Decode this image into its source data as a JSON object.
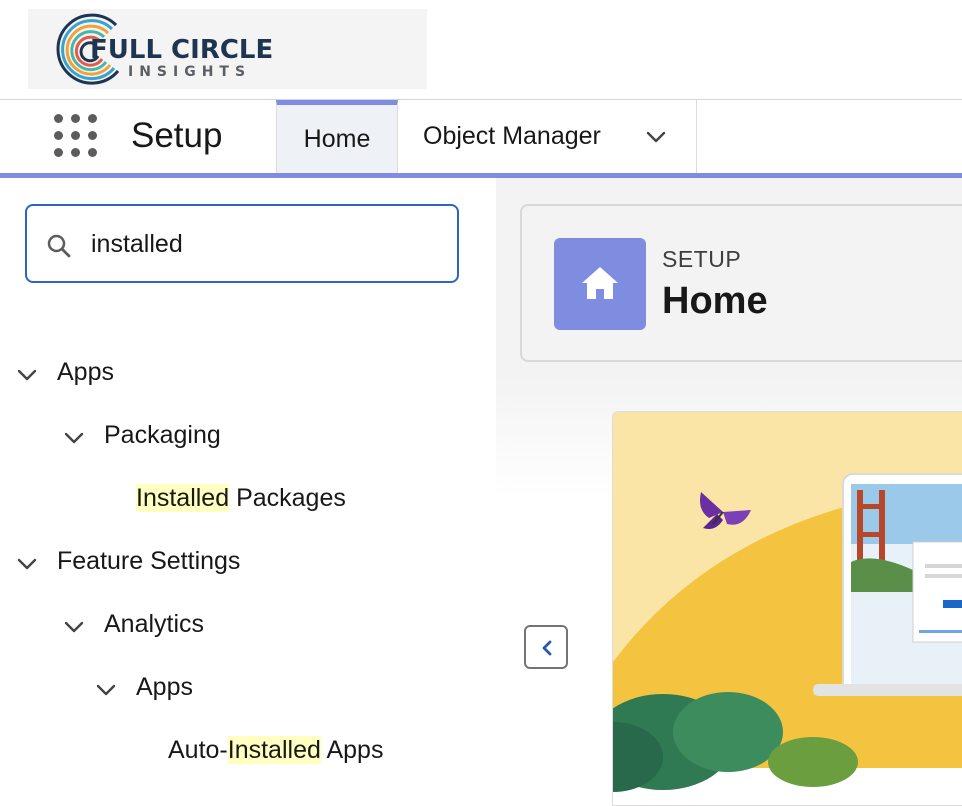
{
  "logo": {
    "line1": "FULL CIRCLE",
    "line2": "INSIGHTS"
  },
  "nav": {
    "app_launcher_icon": "app-launcher-grid-icon",
    "app_name": "Setup",
    "tabs": [
      {
        "label": "Home",
        "active": true
      },
      {
        "label": "Object Manager",
        "has_dropdown": true
      }
    ],
    "accent_color": "#7f8de1"
  },
  "sidebar": {
    "search": {
      "value": "installed",
      "icon": "search-icon",
      "focus_color": "#2c64c8"
    },
    "tree": {
      "apps": {
        "label": "Apps",
        "expanded": true
      },
      "packaging": {
        "label": "Packaging",
        "expanded": true
      },
      "installed_packages": {
        "match": "Installed",
        "rest": " Packages"
      },
      "feature_settings": {
        "label": "Feature Settings",
        "expanded": true
      },
      "analytics": {
        "label": "Analytics",
        "expanded": true
      },
      "analytics_apps": {
        "label": "Apps",
        "expanded": true
      },
      "auto_installed_apps": {
        "before": "Auto-",
        "match": "Installed",
        "after": " Apps"
      }
    },
    "highlight_color": "#ffffc2"
  },
  "main": {
    "header": {
      "eyebrow": "SETUP",
      "title": "Home",
      "icon": "home-icon"
    },
    "collapse_icon": "chevron-left-icon"
  }
}
